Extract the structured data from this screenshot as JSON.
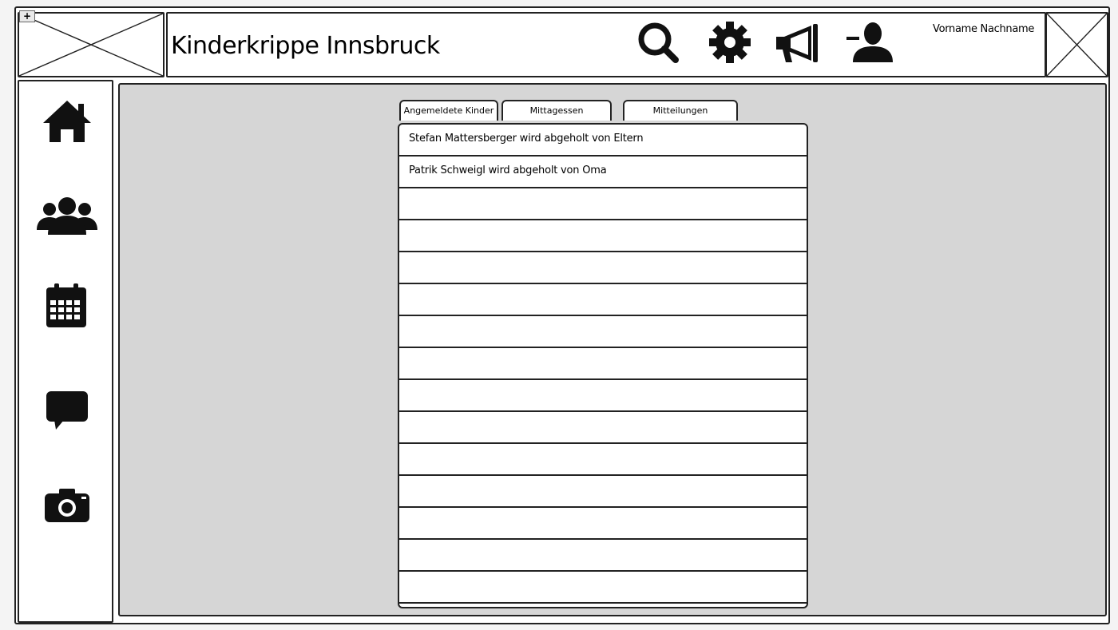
{
  "header": {
    "title": "Kinderkrippe Innsbruck",
    "user_name": "Vorname Nachname",
    "icons": [
      "search-icon",
      "gear-icon",
      "megaphone-icon",
      "user-icon"
    ]
  },
  "sidebar": {
    "items": [
      "home-icon",
      "group-icon",
      "calendar-icon",
      "chat-icon",
      "camera-icon"
    ]
  },
  "tabs": [
    {
      "label": "Angemeldete Kinder"
    },
    {
      "label": "Mittagessen"
    },
    {
      "label": "Mitteilungen"
    }
  ],
  "list": {
    "rows": [
      "Stefan Mattersberger wird abgeholt von Eltern",
      "Patrik Schweigl wird abgeholt von Oma",
      "",
      "",
      "",
      "",
      "",
      "",
      "",
      "",
      "",
      "",
      "",
      "",
      ""
    ]
  },
  "colors": {
    "main_background": "#d6d6d6",
    "panel": "#ffffff",
    "ink": "#111111"
  }
}
